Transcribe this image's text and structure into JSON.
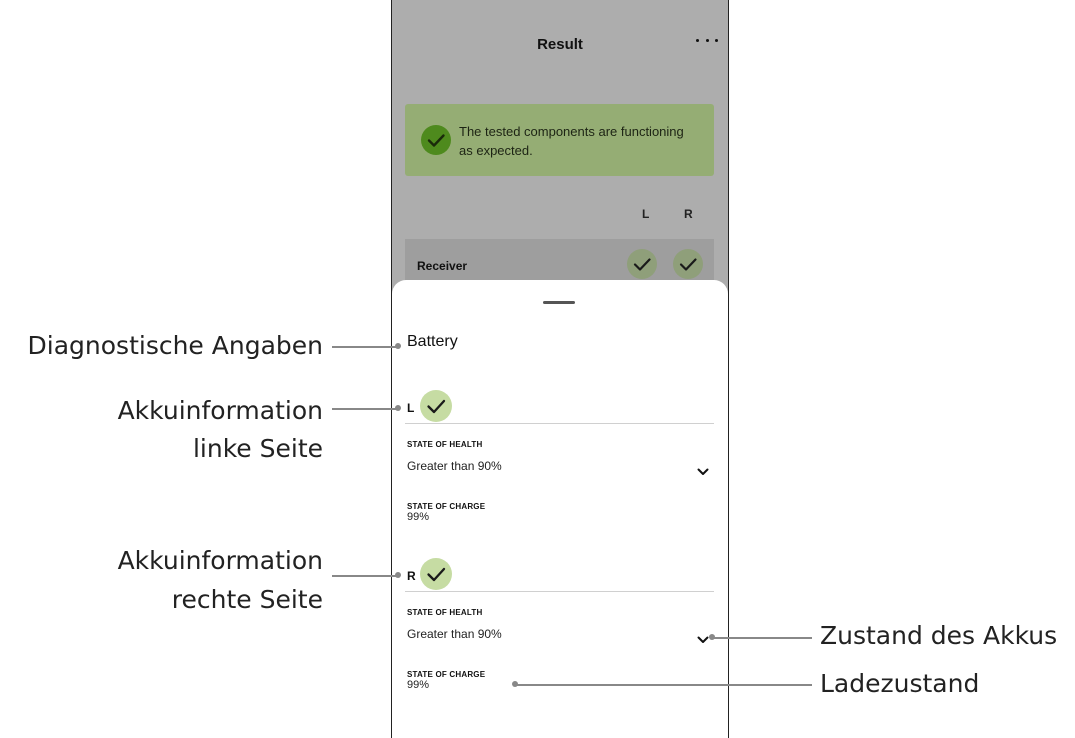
{
  "app": {
    "title": "Result"
  },
  "banner": {
    "text": "The tested components are functioning as expected.",
    "icon": "check-icon"
  },
  "columns": {
    "left": "L",
    "right": "R"
  },
  "receiver": {
    "label": "Receiver"
  },
  "sheet": {
    "title": "Battery",
    "left": {
      "side": "L",
      "health_label": "STATE OF HEALTH",
      "health_value": "Greater than 90%",
      "charge_label": "STATE OF CHARGE",
      "charge_value": "99%"
    },
    "right": {
      "side": "R",
      "health_label": "STATE OF HEALTH",
      "health_value": "Greater than 90%",
      "charge_label": "STATE OF CHARGE",
      "charge_value": "99%"
    }
  },
  "callouts": {
    "diagnostics": "Diagnostische Angaben",
    "left_line1": "Akkuinformation",
    "left_line2": "linke Seite",
    "right_line1": "Akkuinformation",
    "right_line2": "rechte Seite",
    "health": "Zustand des Akkus",
    "charge": "Ladezustand"
  },
  "colors": {
    "overlay": "#adadad",
    "banner": "#95ad74",
    "check_dark": "#4e8a1d",
    "check_light": "#c6dca3"
  }
}
